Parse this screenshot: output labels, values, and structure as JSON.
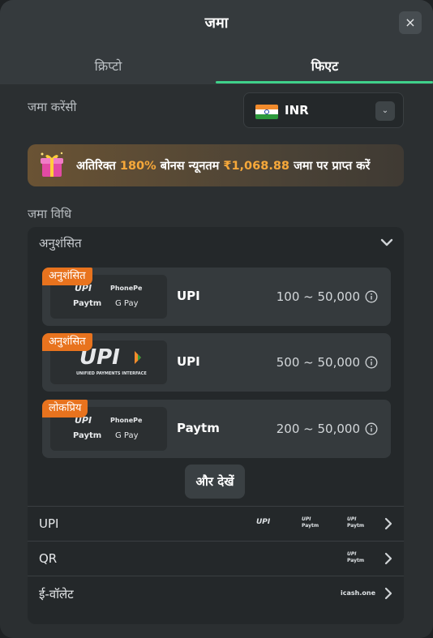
{
  "modal": {
    "title": "जमा",
    "close_label": "×",
    "tabs": [
      {
        "label": "क्रिप्टो",
        "active": false
      },
      {
        "label": "फिएट",
        "active": true
      }
    ]
  },
  "currency": {
    "label": "जमा करेंसी",
    "selected": "INR",
    "flag_icon": "india-flag-icon"
  },
  "bonus": {
    "prefix": "अतिरिक्त ",
    "percent": "180%",
    "middle": " बोनस न्यूनतम ",
    "amount": "₹1,068.88",
    "suffix": " जमा पर प्राप्त करें"
  },
  "method_section": {
    "label": "जमा विधि",
    "recommended_title": "अनुशंसित",
    "cards": [
      {
        "tag": "अनुशंसित",
        "name": "UPI",
        "range": "100 ~ 50,000",
        "logo": "upi-phonepe-paytm-gpay"
      },
      {
        "tag": "अनुशंसित",
        "name": "UPI",
        "range": "500 ~ 50,000",
        "logo": "upi-large"
      },
      {
        "tag": "लोकप्रिय",
        "name": "Paytm",
        "range": "200 ~ 50,000",
        "logo": "upi-phonepe-paytm-gpay"
      }
    ],
    "more_label": "और देखें",
    "categories": [
      {
        "label": "UPI"
      },
      {
        "label": "QR"
      },
      {
        "label": "ई-वॉलेट"
      }
    ]
  },
  "logo_text": {
    "upi": "UPI",
    "phonepe": "PhonePe",
    "paytm": "Paytm",
    "gpay": "G Pay",
    "upi_sub": "UNIFIED PAYMENTS INTERFACE",
    "icash": "icash.one"
  },
  "colors": {
    "accent_green": "#3fd18a",
    "tag_orange": "#e8731e",
    "highlight_orange": "#f6a83a"
  }
}
